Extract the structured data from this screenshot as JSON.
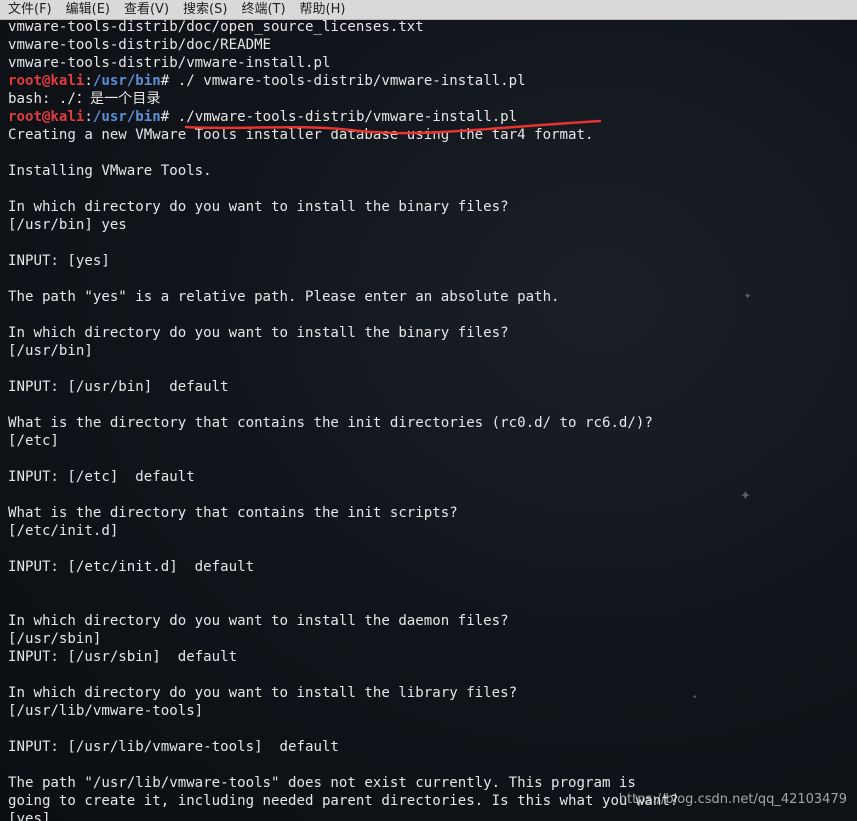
{
  "menu": {
    "file": "文件(F)",
    "edit": "编辑(E)",
    "view": "查看(V)",
    "search": "搜索(S)",
    "terminal": "终端(T)",
    "help": "帮助(H)"
  },
  "prompt": {
    "user": "root@kali",
    "colon": ":",
    "path": "/usr/bin",
    "symbol": "# "
  },
  "terminal": {
    "l0": "vmware-tools-distrib/doc/open_source_licenses.txt",
    "l1": "vmware-tools-distrib/doc/README",
    "l2": "vmware-tools-distrib/vmware-install.pl",
    "l3_cmd": "./ vmware-tools-distrib/vmware-install.pl",
    "l4": "bash: ./：是一个目录",
    "l5_cmd": "./vmware-tools-distrib/vmware-install.pl",
    "l6": "Creating a new VMware Tools installer database using the tar4 format.",
    "l8": "Installing VMware Tools.",
    "l10": "In which directory do you want to install the binary files?",
    "l11": "[/usr/bin] yes",
    "l13": "INPUT: [yes]",
    "l15": "The path \"yes\" is a relative path. Please enter an absolute path.",
    "l17": "In which directory do you want to install the binary files?",
    "l18": "[/usr/bin]",
    "l20": "INPUT: [/usr/bin]  default",
    "l22": "What is the directory that contains the init directories (rc0.d/ to rc6.d/)?",
    "l23": "[/etc]",
    "l25": "INPUT: [/etc]  default",
    "l27": "What is the directory that contains the init scripts?",
    "l28": "[/etc/init.d]",
    "l30": "INPUT: [/etc/init.d]  default",
    "l33": "In which directory do you want to install the daemon files?",
    "l34": "[/usr/sbin]",
    "l35": "INPUT: [/usr/sbin]  default",
    "l37": "In which directory do you want to install the library files?",
    "l38": "[/usr/lib/vmware-tools]",
    "l40": "INPUT: [/usr/lib/vmware-tools]  default",
    "l42": "The path \"/usr/lib/vmware-tools\" does not exist currently. This program is",
    "l43": "going to create it, including needed parent directories. Is this what you want?",
    "l44": "[yes]"
  },
  "watermark": "https://blog.csdn.net/qq_42103479",
  "colors": {
    "prompt_user": "#e03c3c",
    "prompt_path": "#5b8fd6",
    "annotation_stroke": "#e8332f"
  }
}
